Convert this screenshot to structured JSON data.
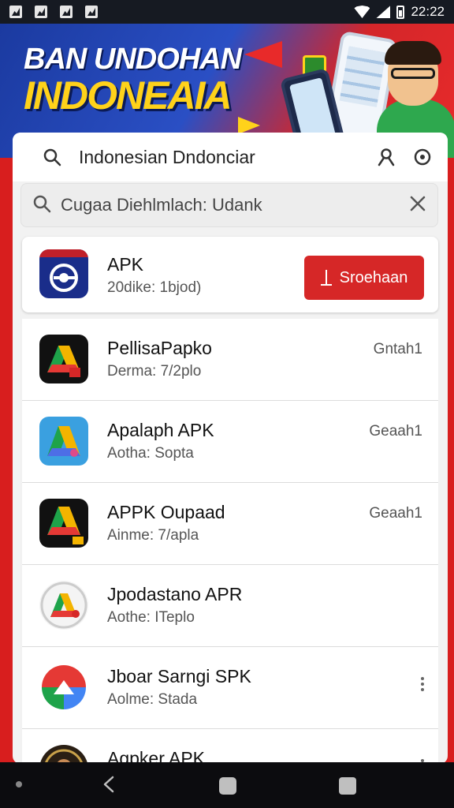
{
  "status_bar": {
    "time": "22:22"
  },
  "banner": {
    "line1": "BAN UNDOHAN",
    "line2": "INDONEAIA"
  },
  "top_bar": {
    "title": "Indonesian Dndonciar"
  },
  "search": {
    "query": "Cugaa Diehlmlach: Udank"
  },
  "featured": {
    "name": "APK",
    "subtitle": "20dike: 1bjod)",
    "button_label": "Sroehaan"
  },
  "apps": [
    {
      "name": "PellisaPapko",
      "subtitle": "Derma: 7/2plo",
      "action": "Gntah1"
    },
    {
      "name": "Apalaph APK",
      "subtitle": "Aotha: Sopta",
      "action": "Geaah1"
    },
    {
      "name": "APPK Oupaad",
      "subtitle": "Ainme: 7/apla",
      "action": "Geaah1"
    },
    {
      "name": "Jpodastano APR",
      "subtitle": "Aothe: ITeplo",
      "action": ""
    },
    {
      "name": "Jboar Sarngi SPK",
      "subtitle": "Aolme: Stada",
      "action": ""
    },
    {
      "name": "Agpker APK",
      "subtitle": "",
      "action": ""
    }
  ],
  "colors": {
    "accent": "#d62727",
    "banner_blue": "#1b3aa0",
    "banner_yellow": "#ffd21a"
  }
}
